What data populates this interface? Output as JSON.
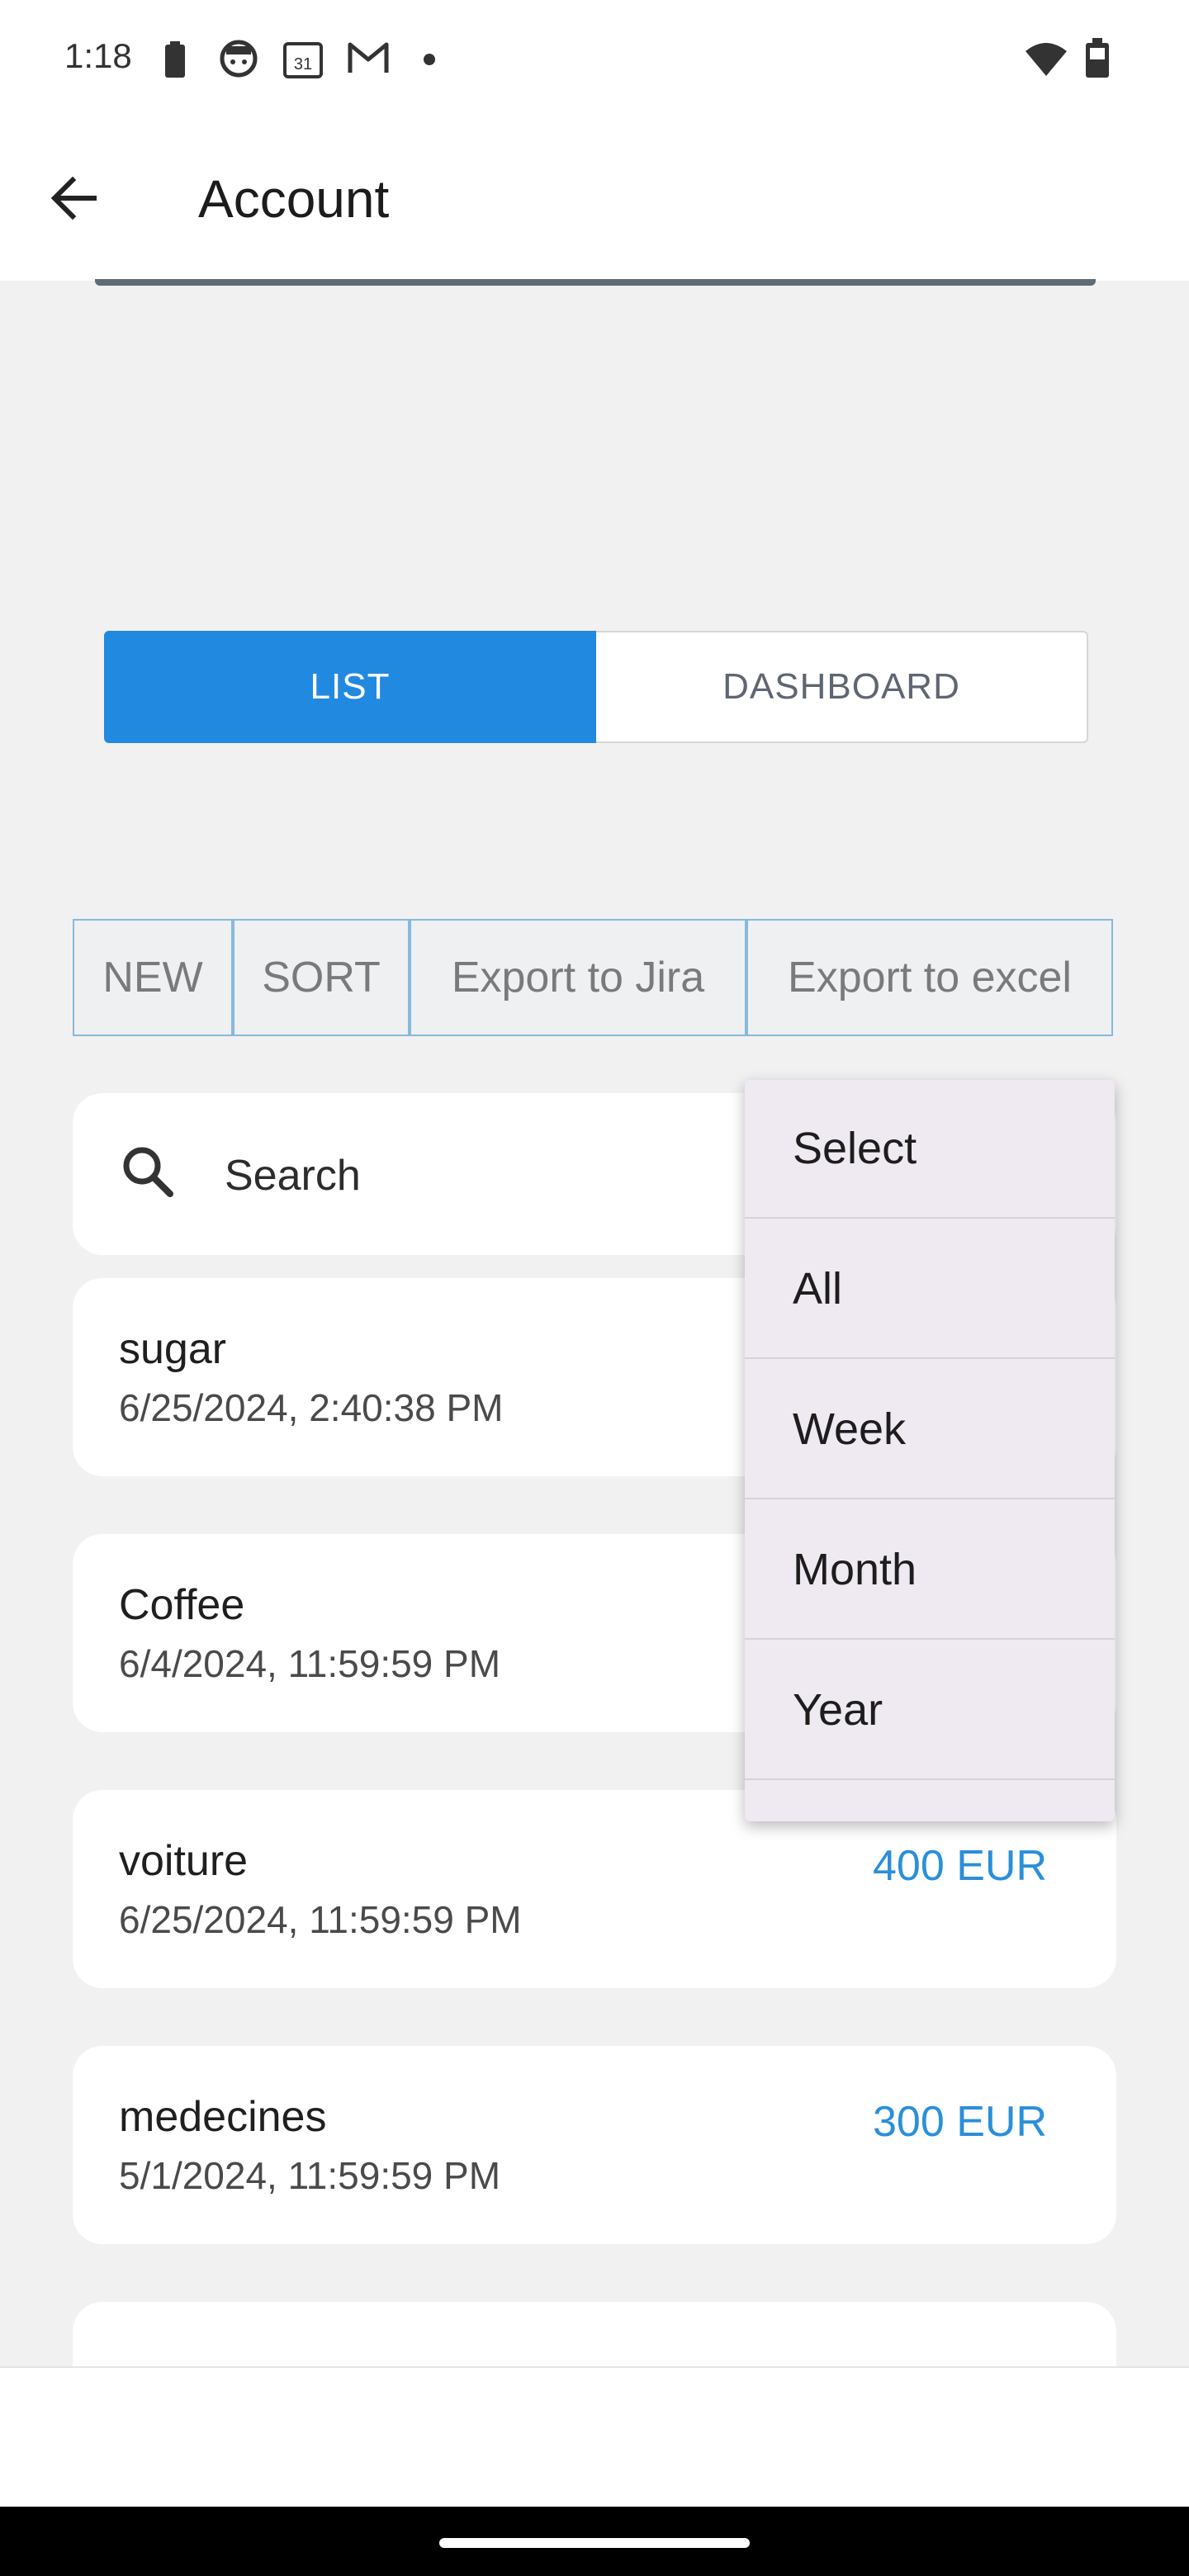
{
  "status_bar": {
    "time": "1:18",
    "icons": [
      "battery-saver-icon",
      "face-icon",
      "calendar-icon",
      "gmail-icon",
      "dot-icon",
      "wifi-icon",
      "battery-icon"
    ],
    "calendar_day": "31"
  },
  "app_bar": {
    "title": "Account",
    "back_icon": "arrow-left-icon"
  },
  "segmented": {
    "list_label": "LIST",
    "dashboard_label": "DASHBOARD",
    "active": "LIST",
    "active_color": "#2289e0"
  },
  "toolbar": {
    "new_label": "NEW",
    "sort_label": "SORT",
    "jira_label": "Export to Jira",
    "excel_label": "Export to excel"
  },
  "search": {
    "placeholder": "Search",
    "icon": "search-icon"
  },
  "items": [
    {
      "name": "sugar",
      "date": "6/25/2024, 2:40:38 PM",
      "amount": ""
    },
    {
      "name": "Coffee",
      "date": "6/4/2024, 11:59:59 PM",
      "amount": ""
    },
    {
      "name": "voiture",
      "date": "6/25/2024, 11:59:59 PM",
      "amount": "400 EUR"
    },
    {
      "name": "medecines",
      "date": "5/1/2024, 11:59:59 PM",
      "amount": "300 EUR"
    }
  ],
  "dropdown": {
    "options": [
      "Select",
      "All",
      "Week",
      "Month",
      "Year"
    ]
  },
  "colors": {
    "accent": "#2289e0",
    "amount": "#2a8fdb",
    "background": "#f1f1f1"
  }
}
